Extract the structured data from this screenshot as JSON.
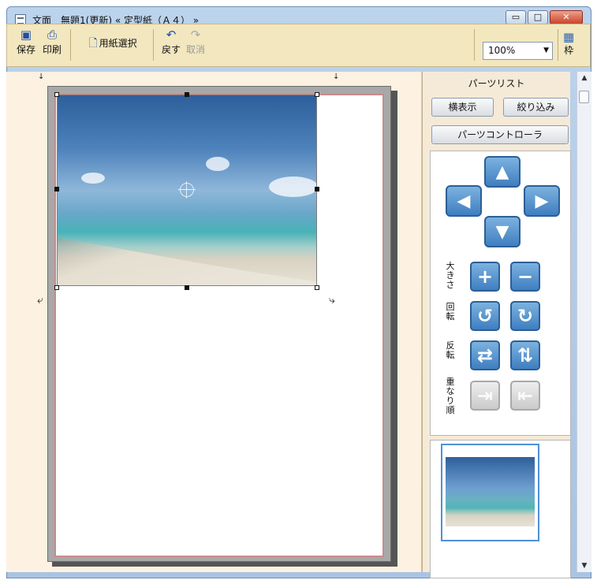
{
  "window": {
    "title": "文面　無題1(更新) « 定型紙（Ａ４） »",
    "min_label": "▭",
    "max_label": "□",
    "close_label": "✕"
  },
  "toolbar": {
    "save_label": "保存",
    "print_label": "印刷",
    "paper_select_label": "用紙選択",
    "undo_label": "戻す",
    "redo_label": "取消",
    "zoom_value": "100%",
    "frame_label": "枠"
  },
  "panel": {
    "title": "パーツリスト",
    "horizontal_view_label": "横表示",
    "filter_label": "絞り込み",
    "parts_controller_label": "パーツコントローラ",
    "size_label": "大きさ",
    "rotate_label": "回転",
    "flip_label": "反転",
    "order_label": "重なり順"
  },
  "icons": {
    "save": "floppy-disk",
    "print": "printer",
    "paper_select": "document",
    "undo": "undo-arrow",
    "redo": "redo-arrow",
    "up": "arrow-up",
    "down": "arrow-down",
    "left": "arrow-left",
    "right": "arrow-right",
    "plus": "plus",
    "minus": "minus",
    "rotate_left": "rotate-left",
    "rotate_right": "rotate-right",
    "flip_horizontal": "flip-horizontal",
    "flip_vertical": "flip-vertical",
    "bring_forward": "bring-forward",
    "send_backward": "send-backward"
  },
  "colors": {
    "toolbar_bg": "#f2e7bf",
    "canvas_bg": "#fdf1e1",
    "accent_blue": "#3f7ec0"
  }
}
